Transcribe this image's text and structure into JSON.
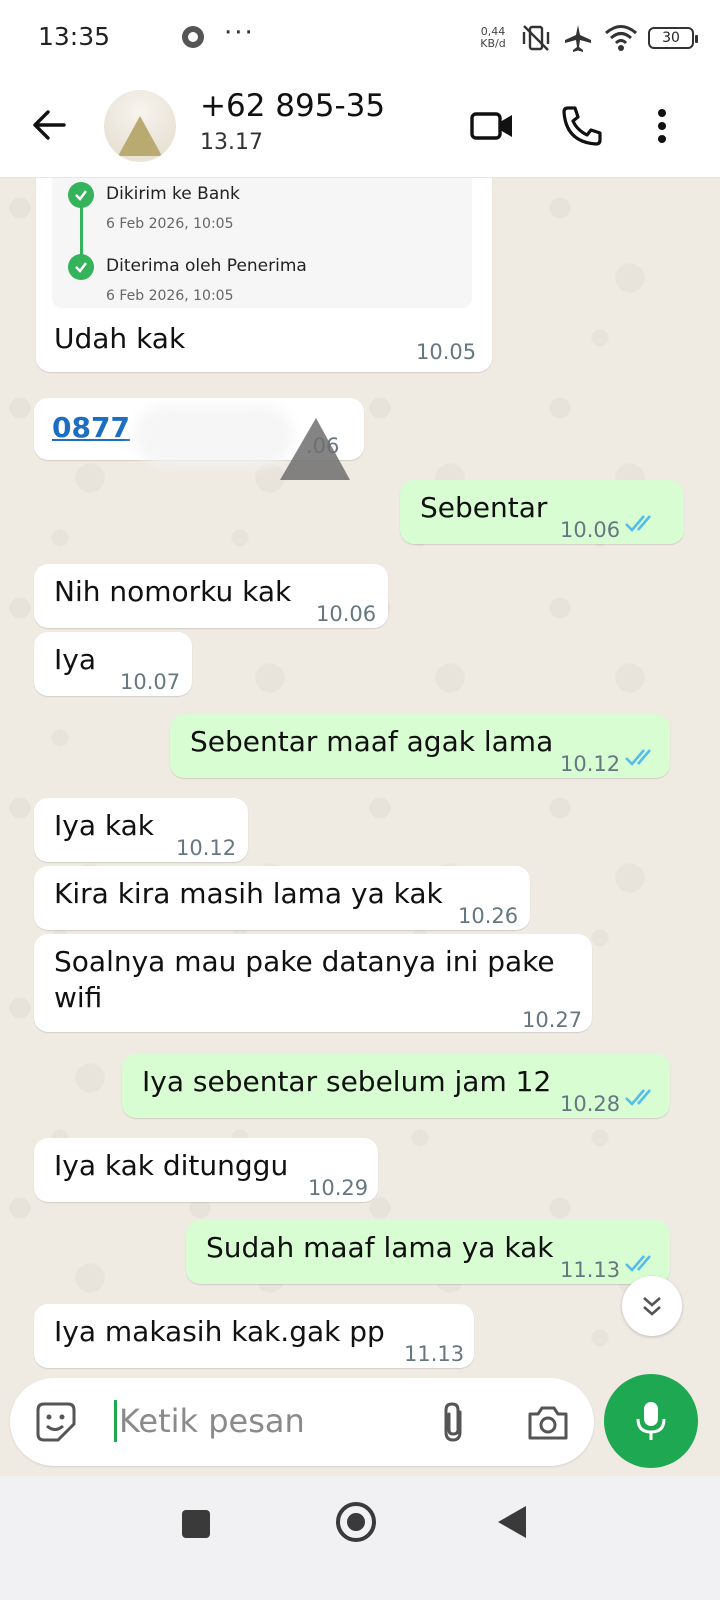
{
  "status_bar": {
    "time": "13:35",
    "more": "···",
    "net_speed_value": "0,44",
    "net_speed_unit": "KB/d",
    "battery": "30"
  },
  "header": {
    "contact_name": "+62 895-35",
    "contact_status": "13.17"
  },
  "receipt": {
    "steps": [
      {
        "title": "Dikirim ke Bank",
        "date": "6 Feb 2026, 10:05"
      },
      {
        "title": "Diterima oleh Penerima",
        "date": "6 Feb 2026, 10:05"
      }
    ]
  },
  "messages": [
    {
      "dir": "in",
      "text": "Udah kak",
      "time": "10.05"
    },
    {
      "dir": "in",
      "text": "0877",
      "time": ".06",
      "link": true
    },
    {
      "dir": "out",
      "text": "Sebentar",
      "time": "10.06"
    },
    {
      "dir": "in",
      "text": "Nih nomorku kak",
      "time": "10.06"
    },
    {
      "dir": "in",
      "text": "Iya",
      "time": "10.07"
    },
    {
      "dir": "out",
      "text": "Sebentar maaf agak lama",
      "time": "10.12"
    },
    {
      "dir": "in",
      "text": "Iya kak",
      "time": "10.12"
    },
    {
      "dir": "in",
      "text": "Kira kira masih lama ya kak",
      "time": "10.26"
    },
    {
      "dir": "in",
      "text": "Soalnya mau pake datanya ini pake",
      "text2": "wifi",
      "time": "10.27"
    },
    {
      "dir": "out",
      "text": "Iya sebentar sebelum jam 12",
      "time": "10.28"
    },
    {
      "dir": "in",
      "text": "Iya kak ditunggu",
      "time": "10.29"
    },
    {
      "dir": "out",
      "text": "Sudah maaf lama ya kak",
      "time": "11.13"
    },
    {
      "dir": "in",
      "text": "Iya makasih kak.gak pp",
      "time": "11.13"
    }
  ],
  "input": {
    "placeholder": "Ketik pesan"
  },
  "colors": {
    "accent": "#1da851",
    "outgoing": "#d9fdd3",
    "incoming": "#ffffff",
    "tick_read": "#53bdeb"
  }
}
